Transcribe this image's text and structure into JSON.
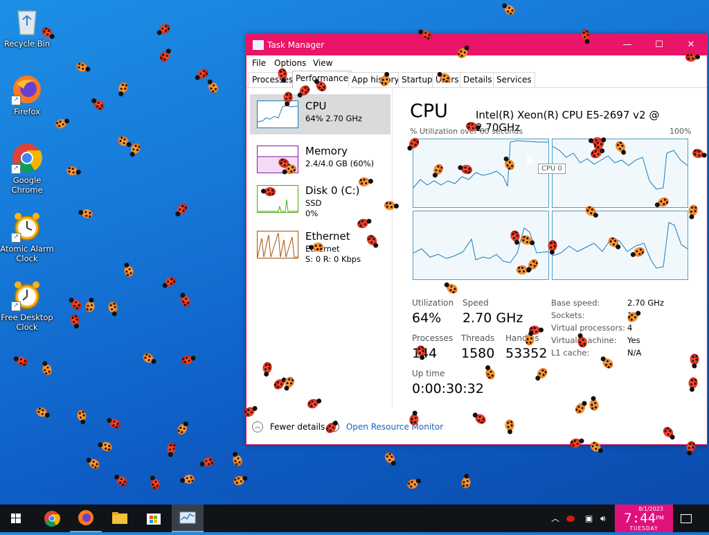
{
  "desktop": {
    "icons": [
      {
        "label": "Recycle Bin",
        "icon": "recycle-bin-icon"
      },
      {
        "label": "Firefox",
        "icon": "firefox-icon"
      },
      {
        "label": "Google Chrome",
        "icon": "chrome-icon"
      },
      {
        "label": "Atomic Alarm Clock",
        "icon": "alarm-clock-icon"
      },
      {
        "label": "Free Desktop Clock",
        "icon": "desktop-clock-icon"
      }
    ]
  },
  "window": {
    "title": "Task Manager",
    "controls": {
      "minimize": "—",
      "maximize": "☐",
      "close": "✕"
    },
    "menu": [
      "File",
      "Options",
      "View"
    ],
    "tabs": [
      "Processes",
      "Performance",
      "App history",
      "Startup",
      "Users",
      "Details",
      "Services"
    ],
    "active_tab": "Performance",
    "sidebar": [
      {
        "title": "CPU",
        "line1": "64% 2.70 GHz",
        "line2": "",
        "color": "#117dbb"
      },
      {
        "title": "Memory",
        "line1": "2.4/4.0 GB (60%)",
        "line2": "",
        "color": "#8b12ae"
      },
      {
        "title": "Disk 0 (C:)",
        "line1": "SSD",
        "line2": "0%",
        "color": "#4da60c"
      },
      {
        "title": "Ethernet",
        "line1": "Ethernet",
        "line2": "S: 0 R: 0 Kbps",
        "color": "#a74f01"
      }
    ],
    "main": {
      "title": "CPU",
      "cpu_model": "Intel(R) Xeon(R) CPU E5-2697 v2 @ 2.70GHz",
      "graph_label": "% Utilization over 60 seconds",
      "graph_max": "100%",
      "tooltip": "CPU 0",
      "stats": {
        "utilization_label": "Utilization",
        "utilization": "64%",
        "speed_label": "Speed",
        "speed": "2.70 GHz",
        "processes_label": "Processes",
        "processes": "144",
        "threads_label": "Threads",
        "threads": "1580",
        "handles_label": "Handles",
        "handles": "53352",
        "uptime_label": "Up time",
        "uptime": "0:00:30:32"
      },
      "details": [
        {
          "k": "Base speed:",
          "v": "2.70 GHz"
        },
        {
          "k": "Sockets:",
          "v": "1"
        },
        {
          "k": "Virtual processors:",
          "v": "4"
        },
        {
          "k": "Virtual machine:",
          "v": "Yes"
        },
        {
          "k": "L1 cache:",
          "v": "N/A"
        }
      ]
    },
    "footer": {
      "fewer_details": "Fewer details",
      "resource_monitor": "Open Resource Monitor"
    }
  },
  "taskbar": {
    "apps": [
      "start-icon",
      "chrome-icon",
      "firefox-icon",
      "file-explorer-icon",
      "store-icon",
      "task-manager-icon"
    ],
    "clock": {
      "date": "8/1/2023",
      "time": "7:44",
      "ampm": "PM",
      "day": "TUESDAY"
    }
  },
  "colors": {
    "title_bar": "#ea1468",
    "clock_bg": "#e0117c",
    "graph_stroke": "#117dbb",
    "graph_border": "#4a9ec5"
  }
}
